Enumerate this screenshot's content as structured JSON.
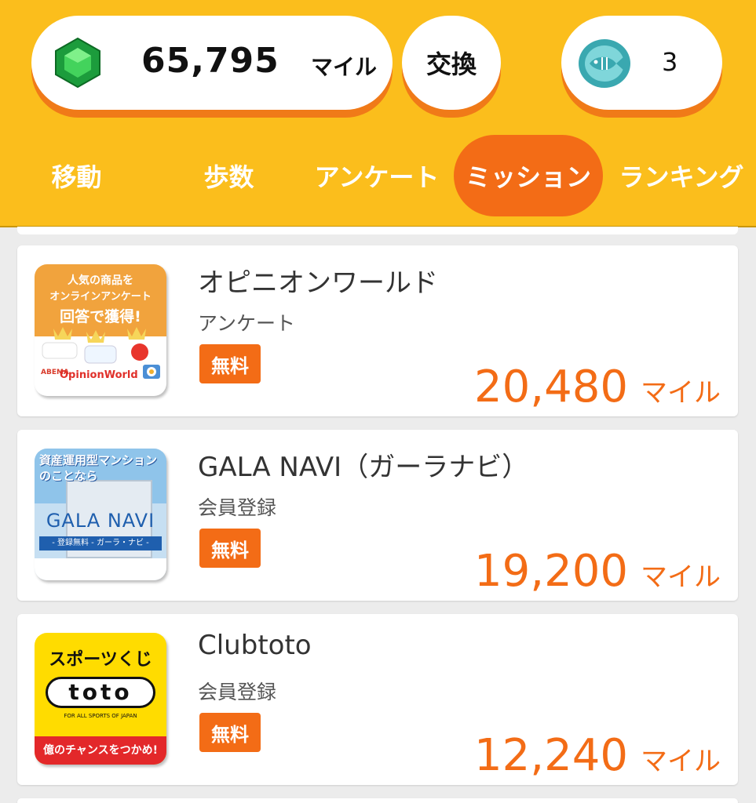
{
  "header": {
    "miles": {
      "value": "65,795",
      "unit": "マイル"
    },
    "exchange_label": "交換",
    "coins": "3"
  },
  "tabs": [
    {
      "label": "移動"
    },
    {
      "label": "歩数"
    },
    {
      "label": "アンケート"
    },
    {
      "label": "ミッション",
      "active": true
    },
    {
      "label": "ランキング"
    }
  ],
  "missions": [
    {
      "title": "オピニオンワールド",
      "category": "アンケート",
      "badge": "無料",
      "reward": "20,480",
      "unit": "マイル",
      "thumb": {
        "line1": "人気の商品を",
        "line2": "オンラインアンケート",
        "line3": "回答で獲得!",
        "brand": "OpinionWorld"
      }
    },
    {
      "title": "GALA NAVI（ガーラナビ）",
      "category": "会員登録",
      "badge": "無料",
      "reward": "19,200",
      "unit": "マイル",
      "thumb": {
        "line1": "資産運用型マンション",
        "line2": "のことなら",
        "logo": "GALA NAVI",
        "sub": "- 登録無料 - ガーラ・ナビ -"
      }
    },
    {
      "title": "Clubtoto",
      "category": "会員登録",
      "badge": "無料",
      "reward": "12,240",
      "unit": "マイル",
      "thumb": {
        "top": "スポーツくじ",
        "logo": "toto",
        "tag": "FOR ALL SPORTS OF JAPAN",
        "bottom": "億のチャンスをつかめ!"
      }
    }
  ],
  "colors": {
    "header_bg": "#fbbe1c",
    "accent": "#f36c16",
    "list_bg": "#ececec"
  }
}
